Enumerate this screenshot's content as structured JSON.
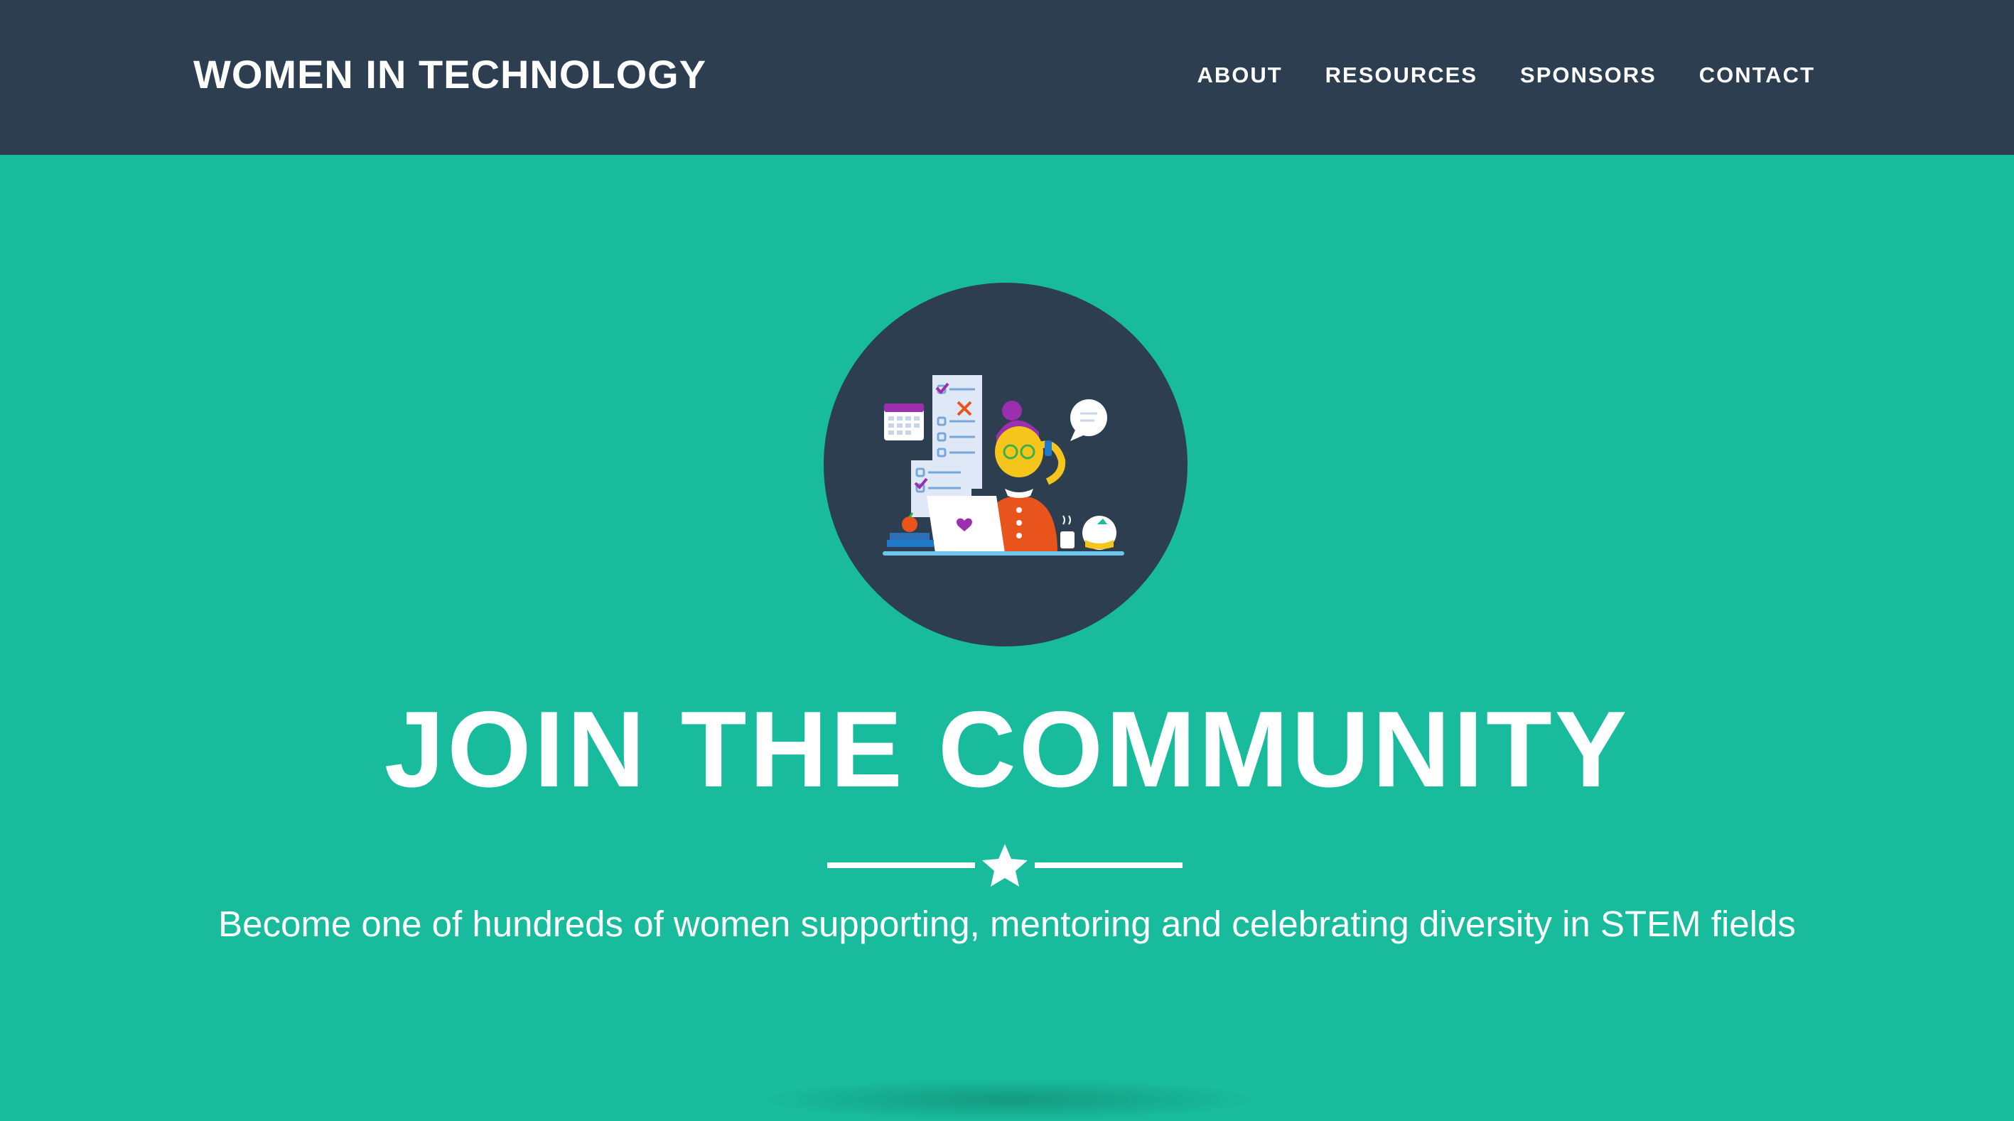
{
  "navbar": {
    "brand": "WOMEN IN TECHNOLOGY",
    "links": [
      {
        "label": "ABOUT"
      },
      {
        "label": "RESOURCES"
      },
      {
        "label": "SPONSORS"
      },
      {
        "label": "CONTACT"
      }
    ]
  },
  "hero": {
    "image_icon": "woman-at-desk-illustration",
    "heading": "JOIN THE COMMUNITY",
    "divider_icon": "star-icon",
    "tagline": "Become one of hundreds of women supporting, mentoring and celebrating diversity in STEM fields"
  },
  "colors": {
    "navbar_bg": "#2c3e50",
    "hero_bg": "#18bc9c",
    "text": "#ffffff",
    "accent_purple": "#9b2fae",
    "accent_orange": "#e8541c",
    "accent_yellow": "#f5c51b"
  }
}
